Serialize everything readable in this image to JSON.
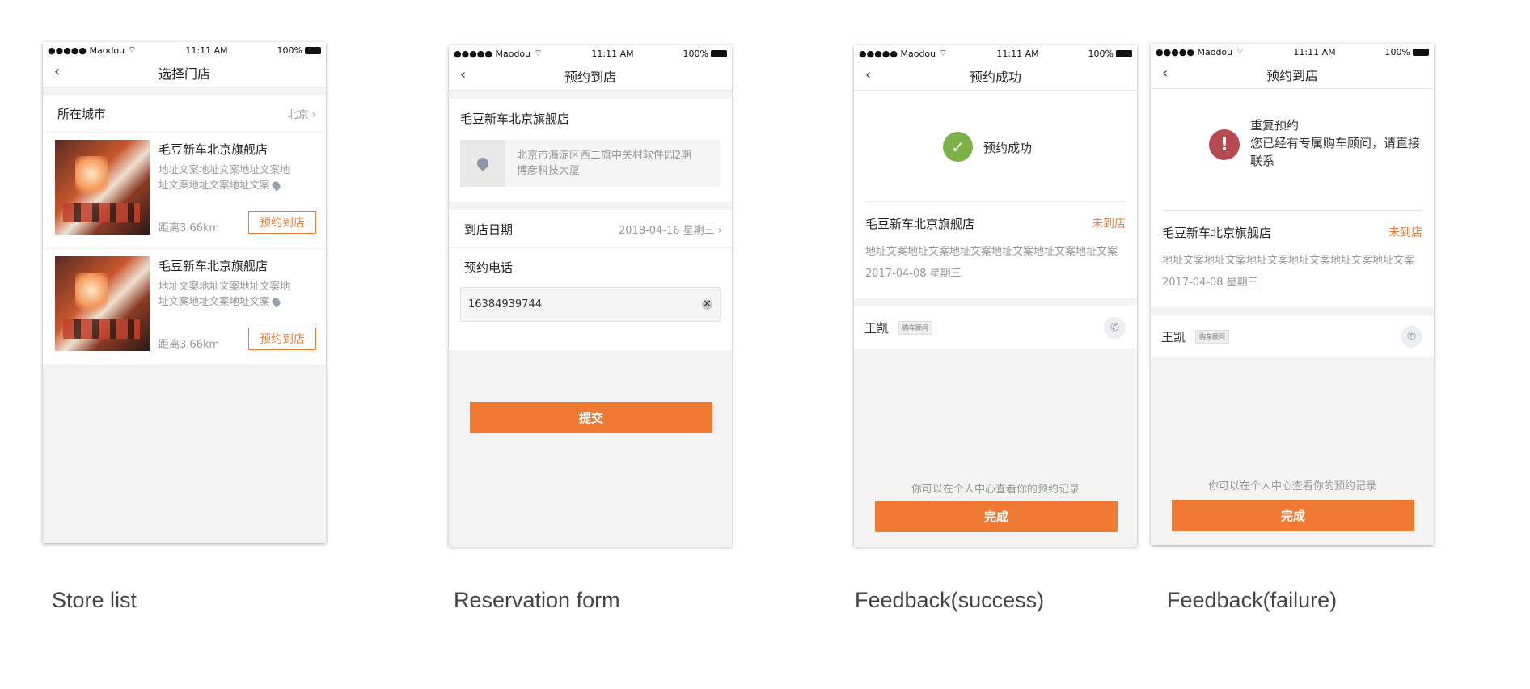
{
  "status_bar": {
    "carrier": "●●●●● Maodou",
    "time": "11:11 AM",
    "battery": "100%"
  },
  "screens": {
    "store_list": {
      "title": "选择门店",
      "city_label": "所在城市",
      "city_value": "北京 ›",
      "stores": [
        {
          "name": "毛豆新车北京旗舰店",
          "address": "地址文案地址文案地址文案地址文案地址文案地址文案",
          "distance": "距离3.66km",
          "button": "预约到店"
        },
        {
          "name": "毛豆新车北京旗舰店",
          "address": "地址文案地址文案地址文案地址文案地址文案地址文案",
          "distance": "距离3.66km",
          "button": "预约到店"
        }
      ]
    },
    "reservation_form": {
      "title": "预约到店",
      "store_name": "毛豆新车北京旗舰店",
      "address": "北京市海淀区西二旗中关村软件园2期博彦科技大厦",
      "date_label": "到店日期",
      "date_value": "2018-04-16   星期三 ›",
      "phone_label": "预约电话",
      "phone_value": "16384939744",
      "submit": "提交"
    },
    "feedback_success": {
      "title": "预约成功",
      "result_text": "预约成功",
      "store_name": "毛豆新车北京旗舰店",
      "status": "未到店",
      "address": "地址文案地址文案地址文案地址文案地址文案地址文案",
      "date": "2017-04-08   星期三",
      "advisor_name": "王凯",
      "advisor_badge": "购车顾问",
      "hint": "你可以在个人中心查看你的预约记录",
      "done": "完成"
    },
    "feedback_failure": {
      "title": "预约到店",
      "result_title": "重复预约",
      "result_message": "您已经有专属购车顾问，请直接联系",
      "store_name": "毛豆新车北京旗舰店",
      "status": "未到店",
      "address": "地址文案地址文案地址文案地址文案地址文案地址文案",
      "date": "2017-04-08   星期三",
      "advisor_name": "王凯",
      "advisor_badge": "购车顾问",
      "hint": "你可以在个人中心查看你的预约记录",
      "done": "完成"
    }
  },
  "captions": {
    "store_list": "Store list",
    "reservation_form": "Reservation form",
    "feedback_success": "Feedback(success)",
    "feedback_failure": "Feedback(failure)"
  },
  "colors": {
    "accent": "#f07a33",
    "success": "#7db049",
    "error": "#b54a52"
  }
}
